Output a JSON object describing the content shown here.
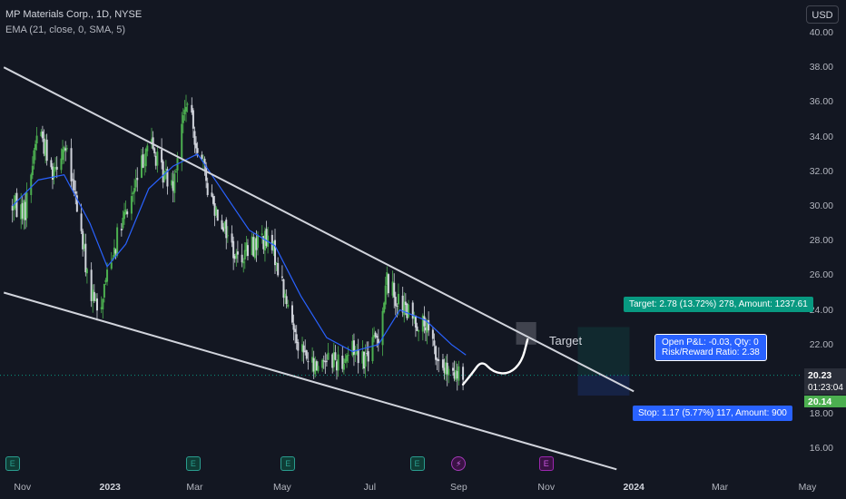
{
  "header": {
    "title": "MP Materials Corp., 1D, NYSE",
    "indicator": "EMA (21, close, 0, SMA, 5)"
  },
  "currency": "USD",
  "colors": {
    "background": "#131722",
    "up": "#4caf50",
    "down": "#d1d4dc",
    "ema": "#2962ff",
    "channel": "#d1d4dc",
    "target_green": "#089981",
    "stop_blue": "#2962ff"
  },
  "chart_data": {
    "type": "candlestick",
    "y_axis": {
      "ticks": [
        "16.00",
        "18.00",
        "20.00",
        "22.00",
        "24.00",
        "26.00",
        "28.00",
        "30.00",
        "32.00",
        "34.00",
        "36.00",
        "38.00",
        "40.00"
      ]
    },
    "x_axis": {
      "ticks": [
        "Nov",
        "2023",
        "Mar",
        "May",
        "Jul",
        "Sep",
        "Nov",
        "2024",
        "Mar",
        "May"
      ]
    },
    "price_path": [
      {
        "x": "2022-10-25",
        "v": 30.0
      },
      {
        "x": "2022-11-03",
        "v": 29.8
      },
      {
        "x": "2022-11-12",
        "v": 34.8
      },
      {
        "x": "2022-11-21",
        "v": 32.0
      },
      {
        "x": "2022-11-30",
        "v": 33.5
      },
      {
        "x": "2022-12-09",
        "v": 30.0
      },
      {
        "x": "2022-12-18",
        "v": 25.0
      },
      {
        "x": "2022-12-24",
        "v": 23.8
      },
      {
        "x": "2023-01-01",
        "v": 27.0
      },
      {
        "x": "2023-01-12",
        "v": 29.5
      },
      {
        "x": "2023-01-20",
        "v": 31.5
      },
      {
        "x": "2023-01-28",
        "v": 34.0
      },
      {
        "x": "2023-02-05",
        "v": 32.0
      },
      {
        "x": "2023-02-14",
        "v": 31.5
      },
      {
        "x": "2023-02-23",
        "v": 36.0
      },
      {
        "x": "2023-03-03",
        "v": 33.5
      },
      {
        "x": "2023-03-12",
        "v": 30.5
      },
      {
        "x": "2023-03-21",
        "v": 29.0
      },
      {
        "x": "2023-03-30",
        "v": 27.0
      },
      {
        "x": "2023-04-08",
        "v": 27.5
      },
      {
        "x": "2023-04-17",
        "v": 28.2
      },
      {
        "x": "2023-04-26",
        "v": 27.2
      },
      {
        "x": "2023-05-05",
        "v": 24.0
      },
      {
        "x": "2023-05-14",
        "v": 21.8
      },
      {
        "x": "2023-05-23",
        "v": 20.6
      },
      {
        "x": "2023-06-01",
        "v": 21.4
      },
      {
        "x": "2023-06-10",
        "v": 21.0
      },
      {
        "x": "2023-06-19",
        "v": 21.8
      },
      {
        "x": "2023-06-28",
        "v": 21.2
      },
      {
        "x": "2023-07-07",
        "v": 22.6
      },
      {
        "x": "2023-07-13",
        "v": 25.7
      },
      {
        "x": "2023-07-22",
        "v": 24.3
      },
      {
        "x": "2023-07-31",
        "v": 23.5
      },
      {
        "x": "2023-08-09",
        "v": 23.0
      },
      {
        "x": "2023-08-18",
        "v": 21.0
      },
      {
        "x": "2023-08-27",
        "v": 20.0
      },
      {
        "x": "2023-09-04",
        "v": 20.23
      }
    ],
    "ema_path": [
      {
        "x": "2022-10-25",
        "v": 30.0
      },
      {
        "x": "2022-11-12",
        "v": 31.5
      },
      {
        "x": "2022-11-30",
        "v": 31.8
      },
      {
        "x": "2022-12-18",
        "v": 29.0
      },
      {
        "x": "2022-12-30",
        "v": 26.5
      },
      {
        "x": "2023-01-12",
        "v": 27.8
      },
      {
        "x": "2023-01-28",
        "v": 31.0
      },
      {
        "x": "2023-02-14",
        "v": 32.3
      },
      {
        "x": "2023-03-03",
        "v": 33.0
      },
      {
        "x": "2023-03-21",
        "v": 30.8
      },
      {
        "x": "2023-04-08",
        "v": 28.6
      },
      {
        "x": "2023-04-26",
        "v": 27.7
      },
      {
        "x": "2023-05-14",
        "v": 24.8
      },
      {
        "x": "2023-06-01",
        "v": 22.4
      },
      {
        "x": "2023-06-19",
        "v": 21.6
      },
      {
        "x": "2023-07-07",
        "v": 22.0
      },
      {
        "x": "2023-07-22",
        "v": 24.0
      },
      {
        "x": "2023-08-09",
        "v": 23.4
      },
      {
        "x": "2023-08-27",
        "v": 22.0
      },
      {
        "x": "2023-09-06",
        "v": 21.4
      }
    ],
    "channel_upper": [
      {
        "x": "2022-10-19",
        "v": 38.0
      },
      {
        "x": "2024-01-01",
        "v": 19.3
      }
    ],
    "channel_lower": [
      {
        "x": "2022-10-19",
        "v": 25.0
      },
      {
        "x": "2023-12-20",
        "v": 14.8
      }
    ],
    "projection": [
      {
        "x": "2023-09-04",
        "v": 19.7
      },
      {
        "x": "2023-09-10",
        "v": 20.3
      },
      {
        "x": "2023-09-17",
        "v": 21.1
      },
      {
        "x": "2023-09-25",
        "v": 20.4
      },
      {
        "x": "2023-10-06",
        "v": 20.3
      },
      {
        "x": "2023-10-15",
        "v": 21.0
      },
      {
        "x": "2023-10-19",
        "v": 22.3
      }
    ],
    "target_zone": {
      "x1": "2023-10-11",
      "x2": "2023-10-25",
      "v1": 23.3,
      "v2": 22.0
    },
    "last_price_level": 20.23,
    "position": {
      "entry": 20.23,
      "target": 23.01,
      "stop": 19.06,
      "x1": "2023-11-23",
      "x2": "2023-12-29"
    },
    "events": [
      {
        "x": "2022-10-25",
        "kind": "E"
      },
      {
        "x": "2023-02-28",
        "kind": "E"
      },
      {
        "x": "2023-05-05",
        "kind": "E"
      },
      {
        "x": "2023-08-03",
        "kind": "E"
      },
      {
        "x": "2023-09-01",
        "kind": "S"
      },
      {
        "x": "2023-11-01",
        "kind": "P"
      }
    ]
  },
  "annotations": {
    "target_label": "Target",
    "target_box": "Target: 2.78 (13.72%) 278, Amount: 1237.61",
    "stop_box": "Stop: 1.17 (5.77%) 117, Amount: 900",
    "pnl_line1": "Open P&L: -0.03, Qty: 0",
    "pnl_line2": "Risk/Reward Ratio: 2.38",
    "last_price": "20.23",
    "countdown": "01:23:04",
    "ema_value": "20.14"
  }
}
